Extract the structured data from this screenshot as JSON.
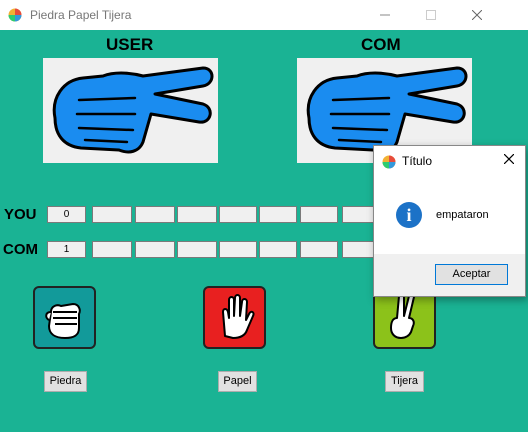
{
  "window": {
    "title": "Piedra Papel Tijera",
    "minimize_icon": "minimize-icon",
    "maximize_icon": "maximize-icon",
    "close_icon": "close-icon"
  },
  "players": {
    "user_label": "USER",
    "com_label": "COM"
  },
  "scoreboard": {
    "you_label": "YOU",
    "com_label": "COM",
    "you_score": "0",
    "com_score": "1"
  },
  "choices": [
    {
      "label": "Piedra",
      "icon": "rock-fist-icon",
      "color": "#129a9a"
    },
    {
      "label": "Papel",
      "icon": "paper-open-hand-icon",
      "color": "#e82020"
    },
    {
      "label": "Tijera",
      "icon": "scissors-hand-icon",
      "color": "#8cc21a"
    }
  ],
  "dialog": {
    "title": "Título",
    "message": "empataron",
    "ok_label": "Aceptar",
    "icon": "info-icon"
  },
  "colors": {
    "background": "#1ab394",
    "hand": "#1a8cf0"
  }
}
